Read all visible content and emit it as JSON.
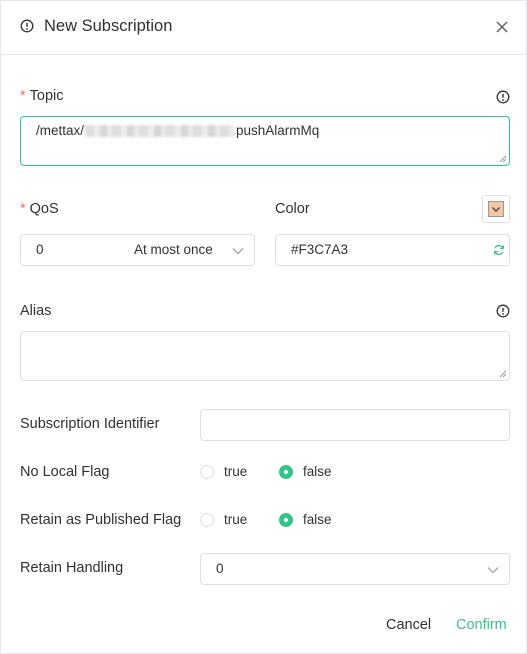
{
  "dialog": {
    "title": "New Subscription"
  },
  "topic": {
    "label": "Topic",
    "required_mark": "*",
    "value_prefix": "/mettax/",
    "value_suffix": "pushAlarmMq"
  },
  "qos": {
    "label": "QoS",
    "required_mark": "*",
    "value": "0",
    "description": "At most once"
  },
  "color": {
    "label": "Color",
    "value": "#F3C7A3",
    "swatch": "#F3C7A3"
  },
  "alias": {
    "label": "Alias",
    "value": ""
  },
  "subscription_identifier": {
    "label": "Subscription Identifier",
    "value": ""
  },
  "no_local_flag": {
    "label": "No Local Flag",
    "options": [
      "true",
      "false"
    ],
    "selected": "false"
  },
  "retain_as_published_flag": {
    "label": "Retain as Published Flag",
    "options": [
      "true",
      "false"
    ],
    "selected": "false"
  },
  "retain_handling": {
    "label": "Retain Handling",
    "value": "0"
  },
  "footer": {
    "cancel_label": "Cancel",
    "confirm_label": "Confirm"
  },
  "colors": {
    "accent": "#34c388",
    "required": "#f56c6c",
    "border": "#dcdfe6",
    "text": "#303133"
  },
  "icons": {
    "title": "info-circle-icon",
    "close": "close-icon",
    "field_help": "info-circle-icon",
    "refresh": "refresh-icon",
    "dropdown": "chevron-down-icon"
  }
}
